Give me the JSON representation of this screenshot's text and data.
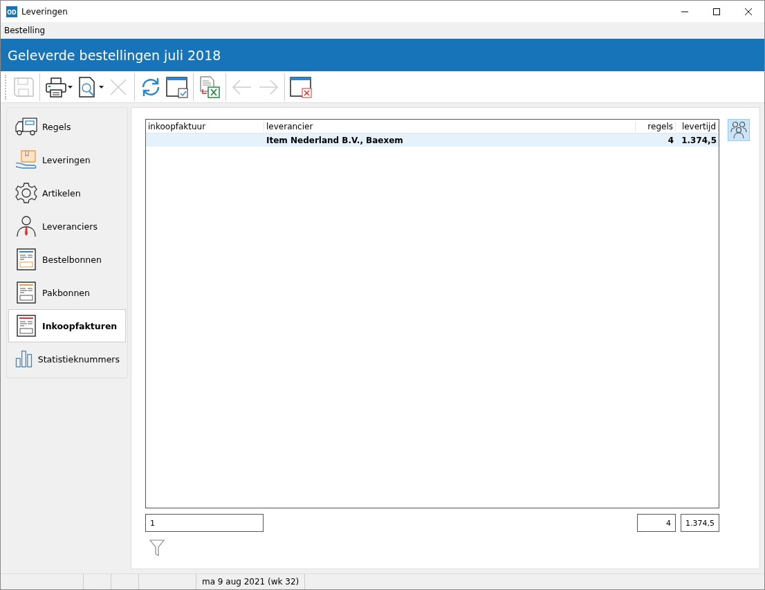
{
  "window": {
    "title": "Leveringen",
    "logo_text": "OD"
  },
  "menu": [
    "Bestelling"
  ],
  "header": {
    "title": "Geleverde bestellingen juli 2018"
  },
  "toolbar": [
    [
      {
        "kind": "save",
        "disabled": true,
        "dropdown": false
      }
    ],
    [
      {
        "kind": "print",
        "disabled": false,
        "dropdown": true
      },
      {
        "kind": "preview",
        "disabled": false,
        "dropdown": true
      },
      {
        "kind": "delete",
        "disabled": true,
        "dropdown": false
      }
    ],
    [
      {
        "kind": "refresh",
        "disabled": false,
        "dropdown": false
      },
      {
        "kind": "select",
        "disabled": false,
        "dropdown": false
      }
    ],
    [
      {
        "kind": "excel",
        "disabled": false,
        "dropdown": false
      }
    ],
    [
      {
        "kind": "back",
        "disabled": true,
        "dropdown": false
      },
      {
        "kind": "forward",
        "disabled": true,
        "dropdown": false
      }
    ],
    [
      {
        "kind": "close",
        "disabled": false,
        "dropdown": false
      }
    ]
  ],
  "sidebar": {
    "items": [
      {
        "label": "Regels",
        "kind": "truck",
        "selected": false
      },
      {
        "label": "Leveringen",
        "kind": "box",
        "selected": false
      },
      {
        "label": "Artikelen",
        "kind": "gear",
        "selected": false
      },
      {
        "label": "Leveranciers",
        "kind": "person",
        "selected": false
      },
      {
        "label": "Bestelbonnen",
        "kind": "docblue",
        "selected": false
      },
      {
        "label": "Pakbonnen",
        "kind": "docorange",
        "selected": false
      },
      {
        "label": "Inkoopfakturen",
        "kind": "docred",
        "selected": true
      },
      {
        "label": "Statistieknummers",
        "kind": "chart",
        "selected": false
      }
    ]
  },
  "table": {
    "columns": [
      "inkoopfaktuur",
      "leverancier",
      "regels",
      "levertijd"
    ],
    "rows": [
      {
        "cells": [
          "",
          "Item Nederland B.V., Baexem",
          "4",
          "1.374,5"
        ],
        "selected": true
      }
    ]
  },
  "totals": [
    "1",
    "4",
    "1.374,5"
  ],
  "status_bar": {
    "date": "ma 9 aug 2021 (wk 32)"
  }
}
